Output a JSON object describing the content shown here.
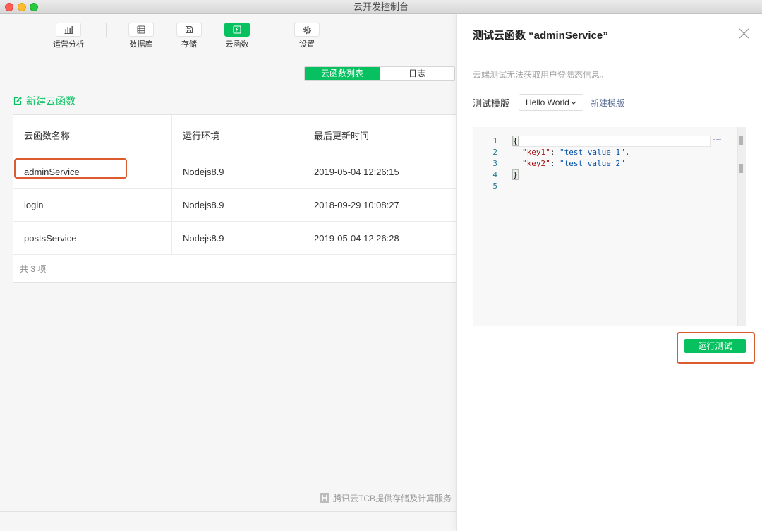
{
  "window": {
    "title": "云开发控制台"
  },
  "colors": {
    "accent": "#07c160",
    "highlight": "#db5a2e",
    "link": "#576b95",
    "json_key": "#a31515",
    "json_string": "#0451a5"
  },
  "toolbar": {
    "items": [
      {
        "label": "运营分析",
        "icon": "bar-chart-icon",
        "active": false
      },
      {
        "label": "数据库",
        "icon": "database-icon",
        "active": false
      },
      {
        "label": "存储",
        "icon": "storage-icon",
        "active": false
      },
      {
        "label": "云函数",
        "icon": "function-icon",
        "active": true
      },
      {
        "label": "设置",
        "icon": "gear-icon",
        "active": false
      }
    ]
  },
  "view_switch": {
    "tabs": [
      {
        "label": "云函数列表",
        "active": true
      },
      {
        "label": "日志",
        "active": false
      }
    ]
  },
  "new_function": {
    "label": "新建云函数",
    "icon": "edit-icon"
  },
  "functions_table": {
    "headers": [
      "云函数名称",
      "运行环境",
      "最后更新时间"
    ],
    "rows": [
      {
        "name": "adminService",
        "runtime": "Nodejs8.9",
        "updated": "2019-05-04 12:26:15",
        "highlighted": true
      },
      {
        "name": "login",
        "runtime": "Nodejs8.9",
        "updated": "2018-09-29 10:08:27",
        "highlighted": false
      },
      {
        "name": "postsService",
        "runtime": "Nodejs8.9",
        "updated": "2019-05-04 12:26:28",
        "highlighted": false
      }
    ],
    "total": "共 3 项"
  },
  "footer": {
    "note": "腾讯云TCB提供存储及计算服务",
    "icon": "tcb-logo-icon"
  },
  "test_panel": {
    "title": "测试云函数 “adminService”",
    "notice": "云端测试无法获取用户登陆态信息。",
    "template_label": "测试模版",
    "template_selected": "Hello World",
    "new_template_link": "新建模版",
    "editor": {
      "line_numbers": [
        "1",
        "2",
        "3",
        "4",
        "5"
      ],
      "lines": [
        {
          "text": "{"
        },
        {
          "key": "\"key1\"",
          "colon": ": ",
          "value": "\"test value 1\"",
          "comma": ","
        },
        {
          "key": "\"key2\"",
          "colon": ": ",
          "value": "\"test value 2\""
        },
        {
          "text": "}"
        },
        {}
      ]
    },
    "run_button": "运行测试",
    "run_button_highlighted": true
  }
}
